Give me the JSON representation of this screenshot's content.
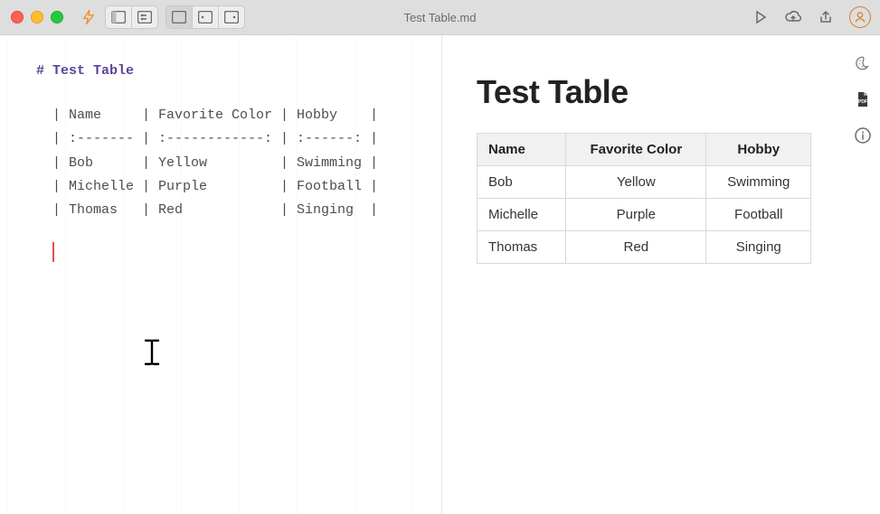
{
  "window": {
    "title": "Test Table.md"
  },
  "editor": {
    "heading": "# Test Table",
    "rows": [
      "| Name     | Favorite Color | Hobby    |",
      "| :------- | :------------: | :------: |",
      "| Bob      | Yellow         | Swimming |",
      "| Michelle | Purple         | Football |",
      "| Thomas   | Red            | Singing  |"
    ]
  },
  "preview": {
    "title": "Test Table",
    "headers": [
      "Name",
      "Favorite Color",
      "Hobby"
    ],
    "rows": [
      [
        "Bob",
        "Yellow",
        "Swimming"
      ],
      [
        "Michelle",
        "Purple",
        "Football"
      ],
      [
        "Thomas",
        "Red",
        "Singing"
      ]
    ]
  }
}
